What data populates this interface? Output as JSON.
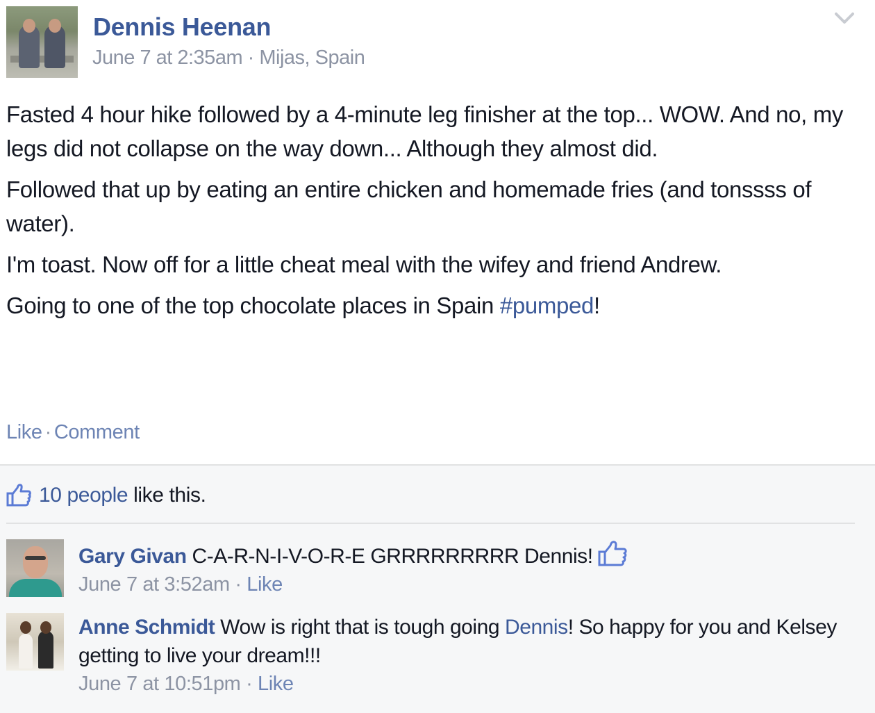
{
  "post": {
    "author": "Dennis Heenan",
    "timestamp": "June 7 at 2:35am",
    "separator": " · ",
    "location": "Mijas, Spain",
    "paragraphs": [
      "Fasted 4 hour hike followed by a 4-minute leg finisher at the top... WOW. And no, my legs did not collapse on the way down... Although they almost did.",
      "Followed that up by eating an entire chicken and homemade fries (and tonssss of water).",
      "I'm toast. Now off for a little cheat meal with the wifey and friend Andrew."
    ],
    "last_paragraph_text": "Going to one of the top chocolate places in Spain ",
    "hashtag": "#pumped",
    "last_paragraph_end": "!",
    "actions": {
      "like": "Like",
      "comment": "Comment",
      "dot": "·"
    },
    "icons": {
      "options": "chevron-down-icon",
      "like": "thumbs-up-icon"
    }
  },
  "likes": {
    "people": "10 people",
    "suffix": " like this."
  },
  "comments": [
    {
      "name": "Gary Givan",
      "text": " C-A-R-N-I-V-O-R-E GRRRRRRRRR Dennis!",
      "timestamp": "June 7 at 3:52am",
      "like": "Like",
      "liked_icon": "thumbs-up-icon"
    },
    {
      "name": "Anne Schmidt",
      "text_before": " Wow is right that is tough going ",
      "mention": "Dennis",
      "text_after": "! So happy for you and Kelsey getting to live your dream!!!",
      "timestamp": "June 7 at 10:51pm",
      "like": "Like"
    }
  ],
  "colors": {
    "link": "#3b5998",
    "muted": "#8c93a3",
    "action": "#6d84b4",
    "feedback_bg": "#f6f7f8"
  }
}
